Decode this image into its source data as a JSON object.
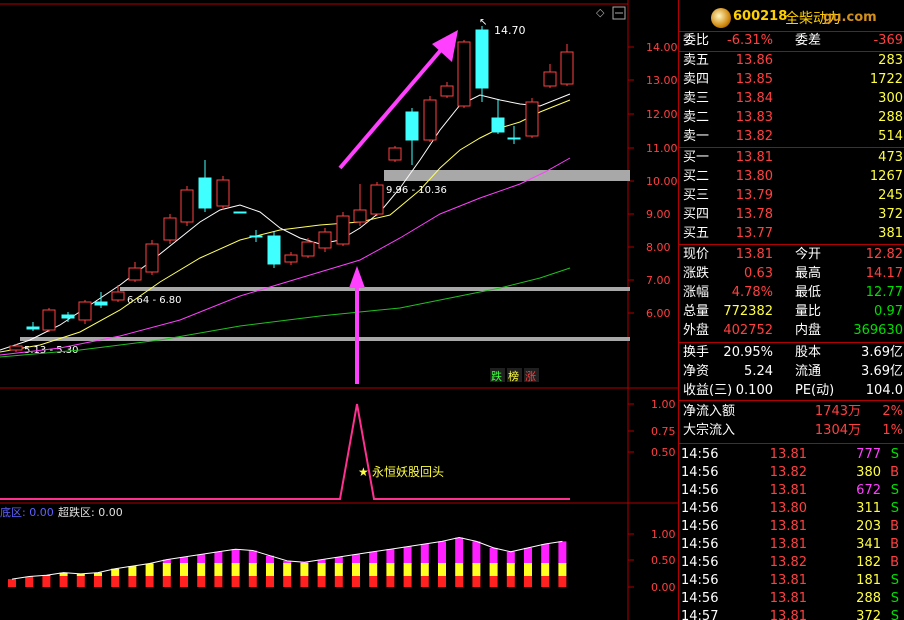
{
  "stock": {
    "code": "600218",
    "name": "全柴动力",
    "watermark": "gu.com"
  },
  "chart": {
    "price_labels": [
      "14.00",
      "13.00",
      "12.00",
      "11.00",
      "10.00",
      "9.00",
      "8.00",
      "7.00",
      "6.00"
    ],
    "peak_label": "14.70",
    "zone_labels": [
      "9.96 - 10.36",
      "6.64 - 6.80",
      "5.13 - 5.30"
    ],
    "tag_buttons": [
      "跌",
      "榜",
      "涨"
    ],
    "signal_axis": [
      "1.00",
      "0.75",
      "0.50"
    ],
    "signal_text": "永恒妖股回头",
    "sub_axis": [
      "1.00",
      "0.50",
      "0.00"
    ],
    "sub_legend": {
      "a_label": "底区: 0.00",
      "b_label": "超跌区: 0.00"
    }
  },
  "chart_data": {
    "type": "line",
    "series": [
      {
        "values": [
          5.3,
          5.5,
          5.6,
          5.9,
          6.1,
          6.5,
          7.0,
          7.6,
          8.5,
          9.3,
          10.2,
          9.2,
          8.9,
          7.4,
          7.6,
          7.8,
          8.0,
          8.6,
          9.0,
          9.5,
          10.0,
          10.5,
          11.7,
          12.2,
          13.2,
          14.3,
          11.2,
          10.9,
          12.4,
          13.7
        ]
      }
    ],
    "ylim": [
      5.0,
      14.8
    ]
  },
  "quote": {
    "wb": {
      "label": "委比",
      "value": "-6.31%",
      "label2": "委差",
      "value2": "-369"
    },
    "asks": [
      {
        "label": "卖五",
        "price": "13.86",
        "vol": "283"
      },
      {
        "label": "卖四",
        "price": "13.85",
        "vol": "1722"
      },
      {
        "label": "卖三",
        "price": "13.84",
        "vol": "300"
      },
      {
        "label": "卖二",
        "price": "13.83",
        "vol": "288"
      },
      {
        "label": "卖一",
        "price": "13.82",
        "vol": "514"
      }
    ],
    "bids": [
      {
        "label": "买一",
        "price": "13.81",
        "vol": "473"
      },
      {
        "label": "买二",
        "price": "13.80",
        "vol": "1267"
      },
      {
        "label": "买三",
        "price": "13.79",
        "vol": "245"
      },
      {
        "label": "买四",
        "price": "13.78",
        "vol": "372"
      },
      {
        "label": "买五",
        "price": "13.77",
        "vol": "381"
      }
    ],
    "stats": [
      {
        "l1": "现价",
        "v1": "13.81",
        "l2": "今开",
        "v2": "12.82",
        "c1": "r",
        "c2": "r"
      },
      {
        "l1": "涨跌",
        "v1": "0.63",
        "l2": "最高",
        "v2": "14.17",
        "c1": "r",
        "c2": "r"
      },
      {
        "l1": "涨幅",
        "v1": "4.78%",
        "l2": "最低",
        "v2": "12.77",
        "c1": "r",
        "c2": "g"
      },
      {
        "l1": "总量",
        "v1": "772382",
        "l2": "量比",
        "v2": "0.97",
        "c1": "y",
        "c2": "g"
      },
      {
        "l1": "外盘",
        "v1": "402752",
        "l2": "内盘",
        "v2": "369630",
        "c1": "r",
        "c2": "g"
      }
    ],
    "stats2": [
      {
        "l1": "换手",
        "v1": "20.95%",
        "l2": "股本",
        "v2": "3.69亿"
      },
      {
        "l1": "净资",
        "v1": "5.24",
        "l2": "流通",
        "v2": "3.69亿"
      },
      {
        "l1": "收益(三)",
        "v1": "0.100",
        "l2": "PE(动)",
        "v2": "104.0"
      }
    ],
    "flow": [
      {
        "label": "净流入额",
        "value": "1743万",
        "pct": "2%"
      },
      {
        "label": "大宗流入",
        "value": "1304万",
        "pct": "1%"
      }
    ],
    "ticks": [
      {
        "time": "14:56",
        "price": "13.81",
        "vol": "777",
        "side": "S",
        "pc": "r",
        "vc": "m",
        "sc": "g"
      },
      {
        "time": "14:56",
        "price": "13.82",
        "vol": "380",
        "side": "B",
        "pc": "r",
        "vc": "y",
        "sc": "r"
      },
      {
        "time": "14:56",
        "price": "13.81",
        "vol": "672",
        "side": "S",
        "pc": "r",
        "vc": "m",
        "sc": "g"
      },
      {
        "time": "14:56",
        "price": "13.80",
        "vol": "311",
        "side": "S",
        "pc": "r",
        "vc": "y",
        "sc": "g"
      },
      {
        "time": "14:56",
        "price": "13.81",
        "vol": "203",
        "side": "B",
        "pc": "r",
        "vc": "y",
        "sc": "r"
      },
      {
        "time": "14:56",
        "price": "13.81",
        "vol": "341",
        "side": "B",
        "pc": "r",
        "vc": "y",
        "sc": "r"
      },
      {
        "time": "14:56",
        "price": "13.82",
        "vol": "182",
        "side": "B",
        "pc": "r",
        "vc": "y",
        "sc": "r"
      },
      {
        "time": "14:56",
        "price": "13.81",
        "vol": "181",
        "side": "S",
        "pc": "r",
        "vc": "y",
        "sc": "g"
      },
      {
        "time": "14:56",
        "price": "13.81",
        "vol": "288",
        "side": "S",
        "pc": "r",
        "vc": "y",
        "sc": "g"
      },
      {
        "time": "14:57",
        "price": "13.81",
        "vol": "372",
        "side": "S",
        "pc": "r",
        "vc": "y",
        "sc": "g"
      }
    ]
  }
}
